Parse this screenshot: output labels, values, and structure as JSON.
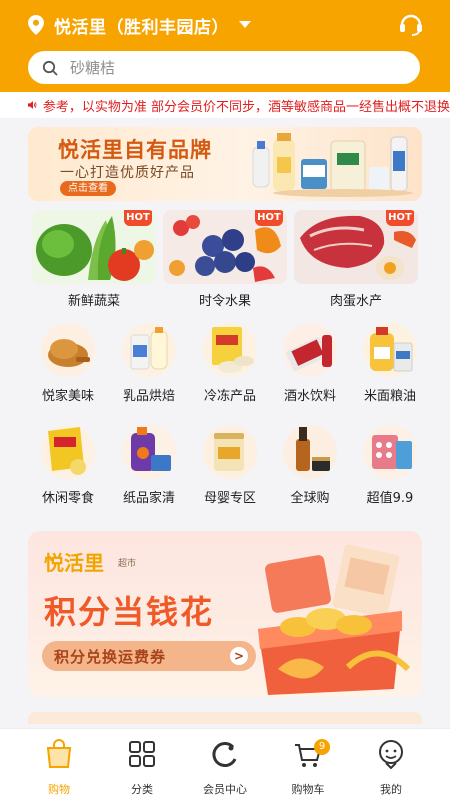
{
  "header": {
    "location": "悦活里（胜利丰园店）",
    "icons": {
      "location": "location-pin-icon",
      "dropdown": "caret-down-icon",
      "support": "headset-icon"
    }
  },
  "search": {
    "placeholder": "砂糖桔",
    "icon": "search-icon"
  },
  "notice": {
    "text": "参考，以实物为准 部分会员价不同步，酒等敏感商品一经售出概不退换",
    "icon": "speaker-icon"
  },
  "banner": {
    "title": "悦活里自有品牌",
    "subtitle": "一心打造优质好产品",
    "button": "点击查看"
  },
  "main_categories": [
    {
      "label": "新鲜蔬菜",
      "badge": "HOT"
    },
    {
      "label": "时令水果",
      "badge": "HOT"
    },
    {
      "label": "肉蛋水产",
      "badge": "HOT"
    }
  ],
  "categories": [
    {
      "label": "悦家美味"
    },
    {
      "label": "乳品烘焙"
    },
    {
      "label": "冷冻产品"
    },
    {
      "label": "酒水饮料"
    },
    {
      "label": "米面粮油"
    },
    {
      "label": "休闲零食"
    },
    {
      "label": "纸品家清"
    },
    {
      "label": "母婴专区"
    },
    {
      "label": "全球购"
    },
    {
      "label": "超值9.9"
    }
  ],
  "promo": {
    "brand": "悦活里",
    "brand_sub": "超市",
    "title": "积分当钱花",
    "button": "积分兑换运费券",
    "arrow": ">"
  },
  "nav": {
    "items": [
      {
        "label": "购物",
        "icon": "shopping-bag-icon"
      },
      {
        "label": "分类",
        "icon": "grid-icon"
      },
      {
        "label": "会员中心",
        "icon": "member-ring-icon"
      },
      {
        "label": "购物车",
        "icon": "cart-icon"
      },
      {
        "label": "我的",
        "icon": "profile-icon"
      }
    ],
    "cart_badge": "9"
  },
  "colors": {
    "brand": "#f7a300",
    "accent": "#f05a28",
    "notice": "#e02020"
  }
}
